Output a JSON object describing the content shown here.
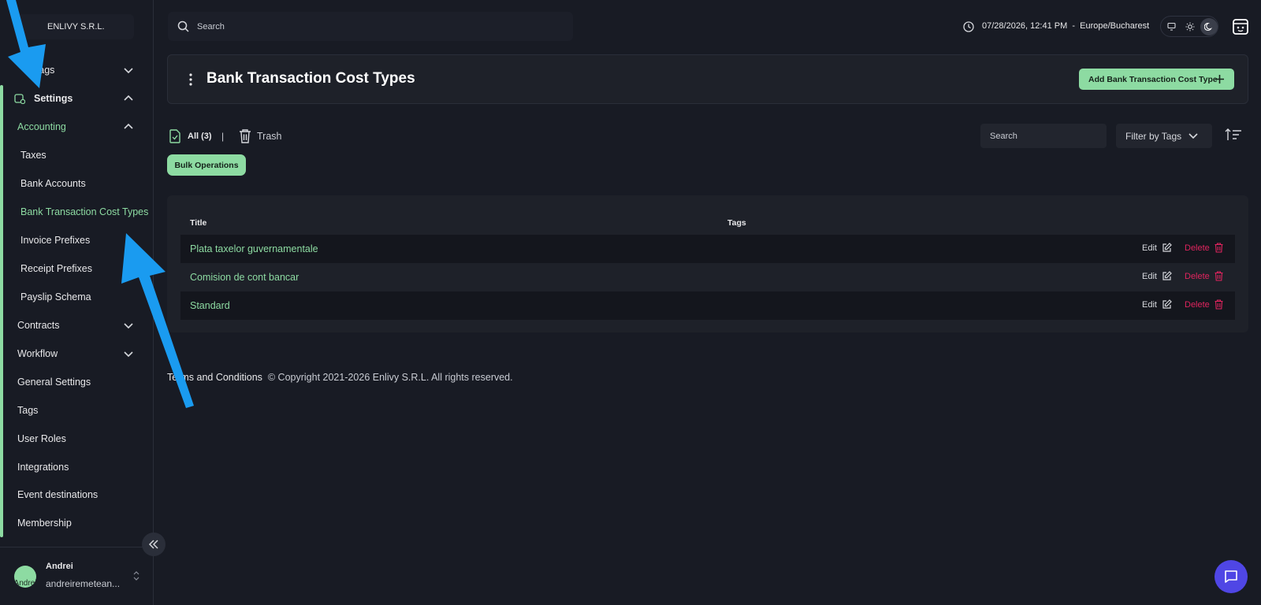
{
  "company": "ENLIVY S.R.L.",
  "sidebar": {
    "collapsed_item_label": "Tags",
    "settings_label": "Settings",
    "accounting_label": "Accounting",
    "accounting_items": [
      "Taxes",
      "Bank Accounts",
      "Bank Transaction Cost Types",
      "Invoice Prefixes",
      "Receipt Prefixes",
      "Payslip Schema"
    ],
    "active_item": "Bank Transaction Cost Types",
    "items": [
      "Contracts",
      "Workflow",
      "General Settings",
      "Tags",
      "User Roles",
      "Integrations",
      "Event destinations",
      "Membership"
    ]
  },
  "user": {
    "name": "Andrei",
    "email": "andreiremetean...",
    "avatar_alt": "Andrei"
  },
  "topbar": {
    "search_placeholder": "Search",
    "datetime": "07/28/2026, 12:41 PM  -  Europe/Bucharest"
  },
  "header": {
    "title": "Bank Transaction Cost Types",
    "add_button": "Add Bank Transaction Cost Type"
  },
  "filters": {
    "all": "All (3)",
    "separator": "|",
    "trash": "Trash",
    "bulk": "Bulk Operations",
    "search_placeholder": "Search",
    "filter_tags": "Filter by Tags"
  },
  "table": {
    "columns": [
      "Title",
      "Tags"
    ],
    "rows": [
      {
        "title": "Plata taxelor guvernamentale",
        "edit": "Edit",
        "delete": "Delete"
      },
      {
        "title": "Comision de cont bancar",
        "edit": "Edit",
        "delete": "Delete"
      },
      {
        "title": "Standard",
        "edit": "Edit",
        "delete": "Delete"
      }
    ]
  },
  "footer": {
    "terms": "Terms and Conditions",
    "copyright": "© Copyright 2021-2026 Enlivy S.R.L. All rights reserved."
  },
  "colors": {
    "accent": "#8ddba2",
    "background": "#181b24",
    "danger": "#e0245e",
    "chat": "#4f46e5",
    "annotation_arrow": "#1a9bf0"
  }
}
